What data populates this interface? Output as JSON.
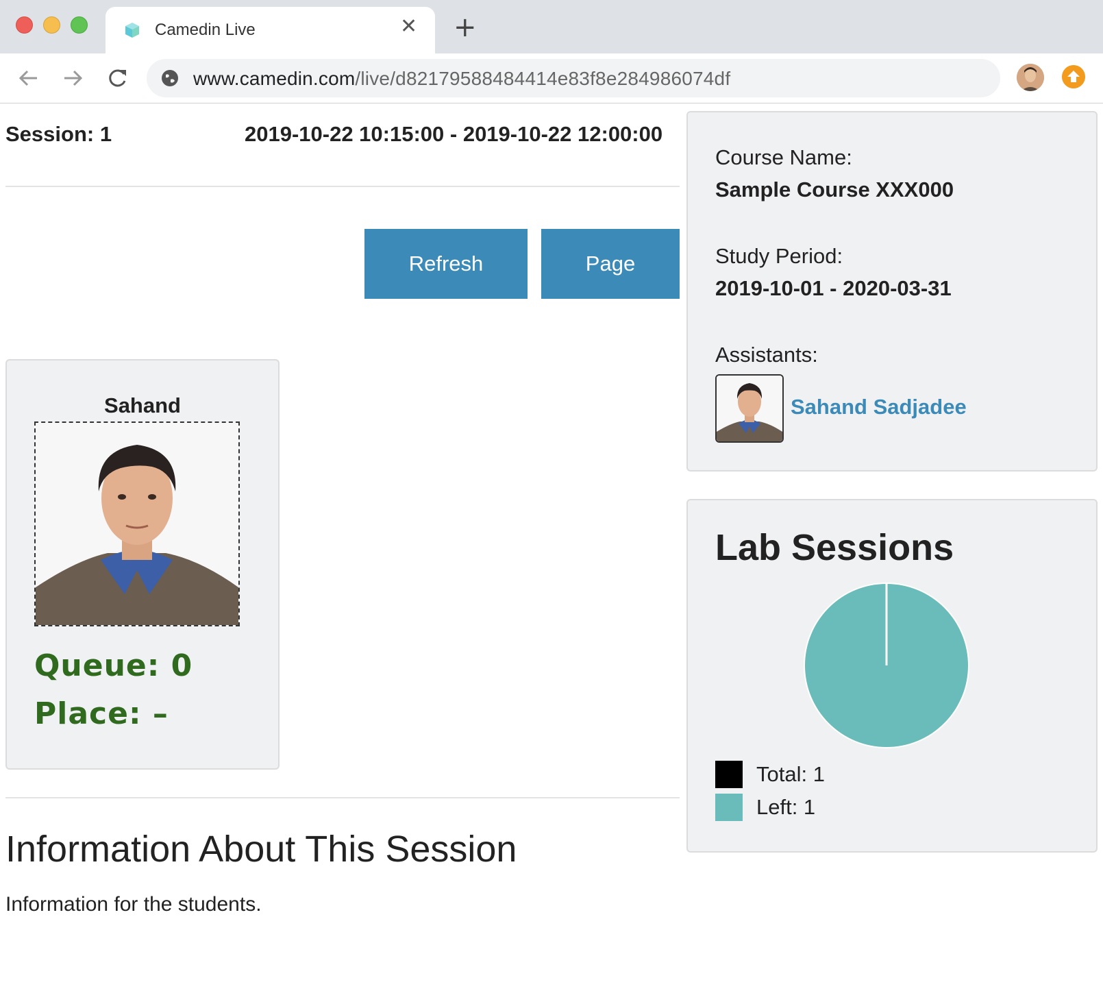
{
  "browser": {
    "tab_title": "Camedin Live",
    "url_host": "www.camedin.com",
    "url_path": "/live/d82179588484414e83f8e284986074df"
  },
  "session": {
    "label": "Session: 1",
    "time_range": "2019-10-22 10:15:00 - 2019-10-22 12:00:00"
  },
  "actions": {
    "refresh_label": "Refresh",
    "page_label": "Page"
  },
  "student_card": {
    "name": "Sahand",
    "queue": "Queue: 0",
    "place": "Place: –"
  },
  "info": {
    "heading": "Information About This Session",
    "text": "Information for the students."
  },
  "course": {
    "course_name_label": "Course Name:",
    "course_name": "Sample Course XXX000",
    "study_period_label": "Study Period:",
    "study_period": "2019-10-01 - 2020-03-31",
    "assistants_label": "Assistants:",
    "assistants": [
      {
        "name": "Sahand Sadjadee"
      }
    ]
  },
  "lab_sessions": {
    "title": "Lab Sessions"
  },
  "chart_data": {
    "type": "pie",
    "title": "Lab Sessions",
    "slices": [
      {
        "label": "Total",
        "value": 1,
        "color": "#000000",
        "legend": "Total: 1"
      },
      {
        "label": "Left",
        "value": 1,
        "color": "#69bcba",
        "legend": "Left: 1"
      }
    ],
    "legend_placement": "bottom-left"
  },
  "colors": {
    "accent": "#3b8ab8",
    "queue_text": "#2f6a1f",
    "pie_fill": "#69bcba"
  },
  "icons": {
    "favicon": "camedin-cube-icon",
    "back": "arrow-left-icon",
    "forward": "arrow-right-icon",
    "reload": "reload-icon",
    "site_info": "globe-icon",
    "profile": "profile-avatar-icon",
    "update": "update-arrow-icon"
  }
}
